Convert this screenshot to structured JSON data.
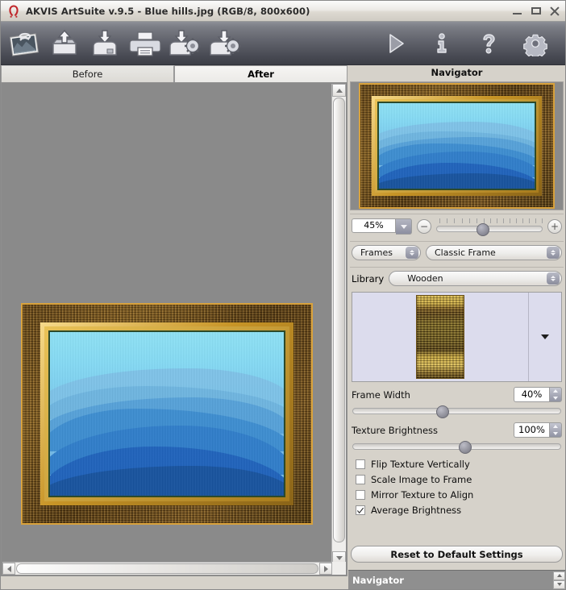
{
  "window": {
    "title": "AKVIS ArtSuite v.9.5 - Blue hills.jpg (RGB/8, 800x600)",
    "logo_icon": "akvis-horseshoe-logo",
    "controls": [
      {
        "name": "minimize",
        "icon": "minimize-icon"
      },
      {
        "name": "maximize",
        "icon": "maximize-icon"
      },
      {
        "name": "close",
        "icon": "close-icon"
      }
    ]
  },
  "toolbar": {
    "left_buttons": [
      {
        "name": "postcard",
        "icon": "postcard-image-icon",
        "tooltip": "Postcard"
      },
      {
        "name": "open",
        "icon": "open-image-icon",
        "tooltip": "Open Image"
      },
      {
        "name": "save",
        "icon": "save-image-icon",
        "tooltip": "Save Image"
      },
      {
        "name": "print",
        "icon": "print-icon",
        "tooltip": "Print Image"
      },
      {
        "name": "load-settings",
        "icon": "load-settings-icon",
        "tooltip": "Load Settings"
      },
      {
        "name": "save-settings",
        "icon": "save-settings-icon",
        "tooltip": "Save Settings"
      }
    ],
    "right_buttons": [
      {
        "name": "run",
        "icon": "run-play-icon",
        "tooltip": "Run"
      },
      {
        "name": "about",
        "icon": "info-icon",
        "tooltip": "About"
      },
      {
        "name": "help",
        "icon": "help-question-icon",
        "tooltip": "Help"
      },
      {
        "name": "preferences",
        "icon": "gear-icon",
        "tooltip": "Preferences"
      }
    ]
  },
  "tabs": {
    "before": "Before",
    "after": "After",
    "active": "After"
  },
  "navigator": {
    "title": "Navigator"
  },
  "zoom": {
    "value": "45%",
    "minus_label": "−",
    "plus_label": "+",
    "dropdown_icon": "chevron-down-icon",
    "slider_position_pct": 38
  },
  "selectors": {
    "category": "Frames",
    "style": "Classic Frame",
    "library_label": "Library",
    "library": "Wooden"
  },
  "texture": {
    "preview_name": "wooden-frame-texture",
    "dropdown_icon": "triangle-down-icon"
  },
  "sliders": [
    {
      "name": "frame-width",
      "label": "Frame Width",
      "value": "40%",
      "position_pct": 40
    },
    {
      "name": "texture-brightness",
      "label": "Texture Brightness",
      "value": "100%",
      "position_pct": 51
    }
  ],
  "checkboxes": [
    {
      "name": "flip-texture-vertically",
      "label": "Flip Texture Vertically",
      "checked": false
    },
    {
      "name": "scale-image-to-frame",
      "label": "Scale Image to Frame",
      "checked": false
    },
    {
      "name": "mirror-texture-to-align",
      "label": "Mirror Texture to Align",
      "checked": false
    },
    {
      "name": "average-brightness",
      "label": "Average Brightness",
      "checked": true
    }
  ],
  "reset_button": "Reset to Default Settings",
  "statusbar": {
    "text": "Navigator"
  },
  "colors": {
    "toolbar_dark": "#5d5f68",
    "panel_bg": "#d6d2ca",
    "canvas_bg": "#8a8a8a",
    "frame_gold": "#d9a23c",
    "frame_wood": "#6d4a18",
    "status_bg": "#8f8f8f"
  }
}
